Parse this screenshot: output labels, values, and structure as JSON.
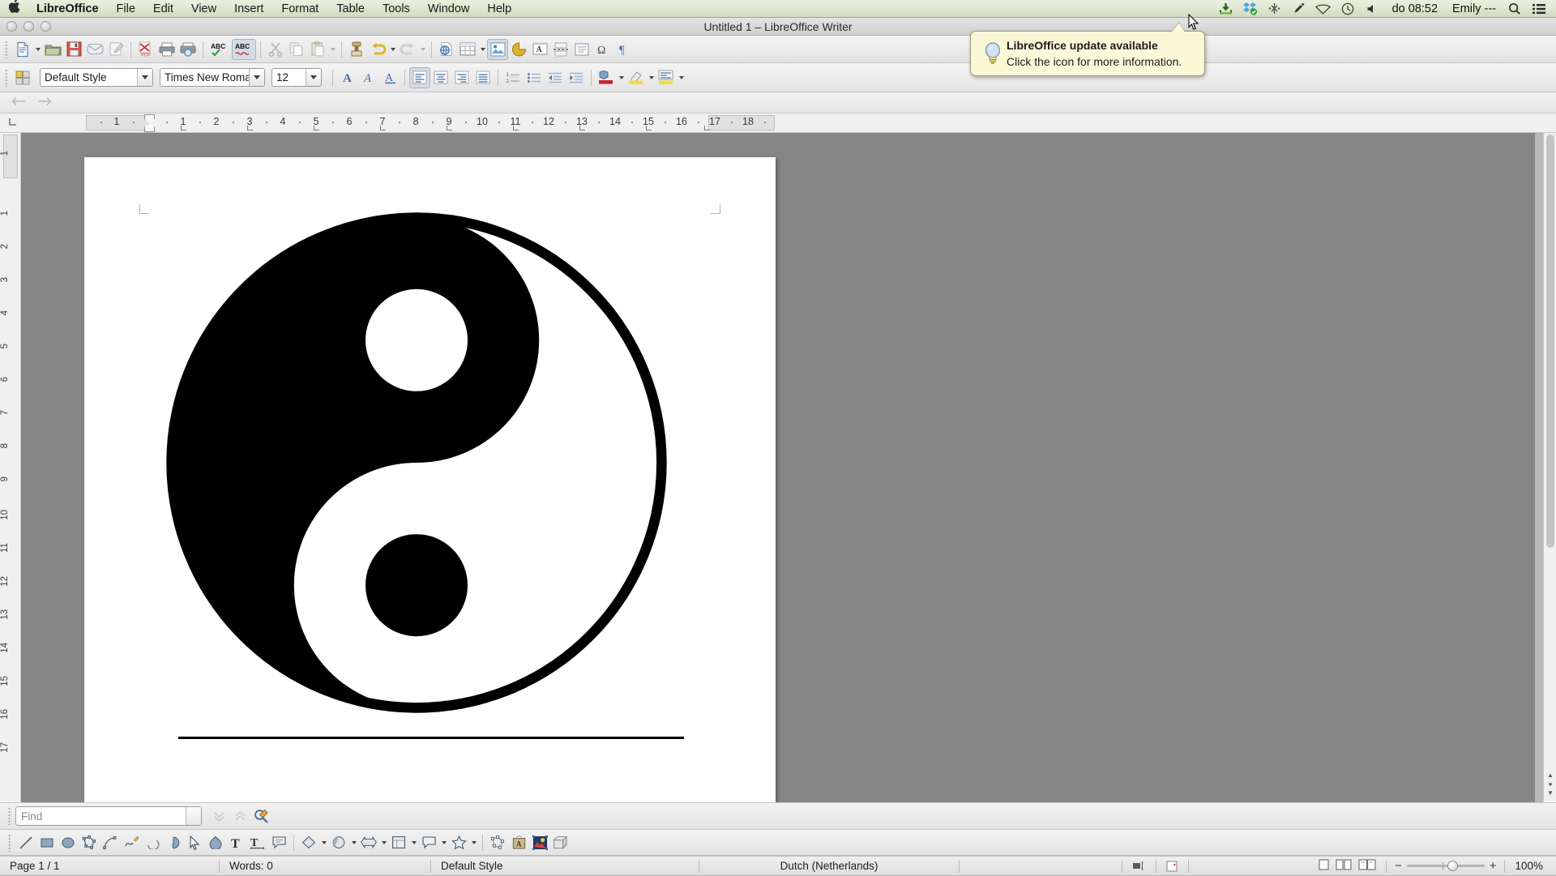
{
  "macbar": {
    "apple_icon": "apple-icon",
    "menus": [
      {
        "label": "LibreOffice",
        "bold": true
      },
      {
        "label": "File"
      },
      {
        "label": "Edit"
      },
      {
        "label": "View"
      },
      {
        "label": "Insert"
      },
      {
        "label": "Format"
      },
      {
        "label": "Table"
      },
      {
        "label": "Tools"
      },
      {
        "label": "Window"
      },
      {
        "label": "Help"
      }
    ],
    "status_icons": [
      "download-icon",
      "dropbox-icon",
      "bluetooth-icon",
      "pen-icon",
      "wifi-icon",
      "timemachine-icon",
      "volume-icon"
    ],
    "clock": "do 08:52",
    "user": "Emily ---",
    "right_icons": [
      "spotlight-search-icon",
      "notification-center-icon"
    ]
  },
  "window": {
    "title": "Untitled 1 – LibreOffice Writer",
    "traffic_lights": [
      "close-button",
      "minimize-button",
      "zoom-button"
    ]
  },
  "tooltip": {
    "icon": "lightbulb-icon",
    "title": "LibreOffice update available",
    "body": "Click the icon for more information."
  },
  "toolbar_standard": {
    "items": [
      "new-document-icon",
      "new-document-dropdown",
      "open-document-icon",
      "save-document-icon",
      "email-document-icon",
      "edit-mode-icon",
      "export-pdf-icon",
      "print-icon",
      "print-preview-icon",
      "spelling-icon",
      "autospellcheck-icon",
      "cut-icon",
      "copy-icon",
      "paste-icon",
      "paste-dropdown",
      "clone-formatting-icon",
      "undo-icon",
      "undo-dropdown",
      "redo-icon",
      "redo-dropdown",
      "hyperlink-icon",
      "insert-table-icon",
      "insert-table-dropdown",
      "insert-image-icon",
      "insert-chart-icon",
      "insert-textbox-icon",
      "page-break-icon",
      "insert-field-icon",
      "special-character-icon",
      "formatting-marks-icon",
      "footnote-icon"
    ]
  },
  "toolbar_formatting": {
    "sidebar_icon": "sidebar-settings-icon",
    "paragraph_style": "Default Style",
    "font_name": "Times New Roma",
    "font_size": "12",
    "buttons": [
      "bold-icon",
      "italic-icon",
      "underline-icon",
      "align-left-icon",
      "align-center-icon",
      "align-right-icon",
      "align-justified-icon",
      "ordered-list-icon",
      "unordered-list-icon",
      "decrease-indent-icon",
      "increase-indent-icon",
      "font-color-icon",
      "font-color-dropdown",
      "highlight-color-icon",
      "highlight-dropdown",
      "paragraph-background-icon",
      "paragraph-background-dropdown"
    ]
  },
  "toolbar_navigation": {
    "buttons": [
      "navigate-back-icon",
      "navigate-forward-icon"
    ]
  },
  "ruler": {
    "corner_icon": "tab-stop-icon",
    "numbers": [
      "1",
      "1",
      "2",
      "3",
      "4",
      "5",
      "6",
      "7",
      "8",
      "9",
      "10",
      "11",
      "12",
      "13",
      "14",
      "15",
      "16",
      "17",
      "18"
    ],
    "unit": "inch"
  },
  "vertical_ruler": {
    "numbers": [
      "1",
      "1",
      "2",
      "3",
      "4",
      "5",
      "6",
      "7",
      "8",
      "9",
      "10",
      "11",
      "12",
      "13",
      "14",
      "15",
      "16",
      "17"
    ]
  },
  "document": {
    "content_description": "yin-yang-symbol-image",
    "has_underline_rule": true,
    "page_background": "#ffffff"
  },
  "find_toolbar": {
    "placeholder": "Find",
    "buttons": [
      "find-dropdown",
      "find-next-icon",
      "find-previous-icon",
      "find-and-replace-icon"
    ]
  },
  "drawing_toolbar": {
    "items": [
      "line-icon",
      "rectangle-icon",
      "ellipse-icon",
      "polygon-icon",
      "curve-icon",
      "freeform-line-icon",
      "arc-icon",
      "ellipse-pie-icon",
      "select-icon",
      "basic-shapes-icon",
      "insert-text-icon",
      "vertical-text-icon",
      "callout-icon",
      "basic-shape-dropdown-icon",
      "basic-shape-caret",
      "symbol-shapes-icon",
      "symbol-shapes-caret",
      "block-arrows-icon",
      "block-arrows-caret",
      "flowchart-icon",
      "flowchart-caret",
      "callouts-icon",
      "callouts-caret",
      "stars-icon",
      "stars-caret",
      "points-icon",
      "fontwork-icon",
      "from-file-icon",
      "extrusion-icon"
    ]
  },
  "statusbar": {
    "page": "Page 1 / 1",
    "words": "Words: 0",
    "style": "Default Style",
    "language": "Dutch (Netherlands)",
    "insert_mode_icon": "insert-mode-icon",
    "selection_mode_icon": "selection-mode-icon",
    "save_status_icon": "unsaved-changes-icon",
    "view_layouts": [
      "single-page-view-icon",
      "multi-page-view-icon",
      "book-view-icon"
    ],
    "zoom_minus": "−",
    "zoom_plus": "+",
    "zoom_level": "100%"
  },
  "colors": {
    "menubar_bg": "#dfe9d2",
    "toolbar_bg": "#eeeeee",
    "canvas_bg": "#868686",
    "page_bg": "#ffffff",
    "tooltip_bg": "#fbf8d8",
    "accent_blue": "#3a6ea5",
    "ink": "#000000"
  }
}
